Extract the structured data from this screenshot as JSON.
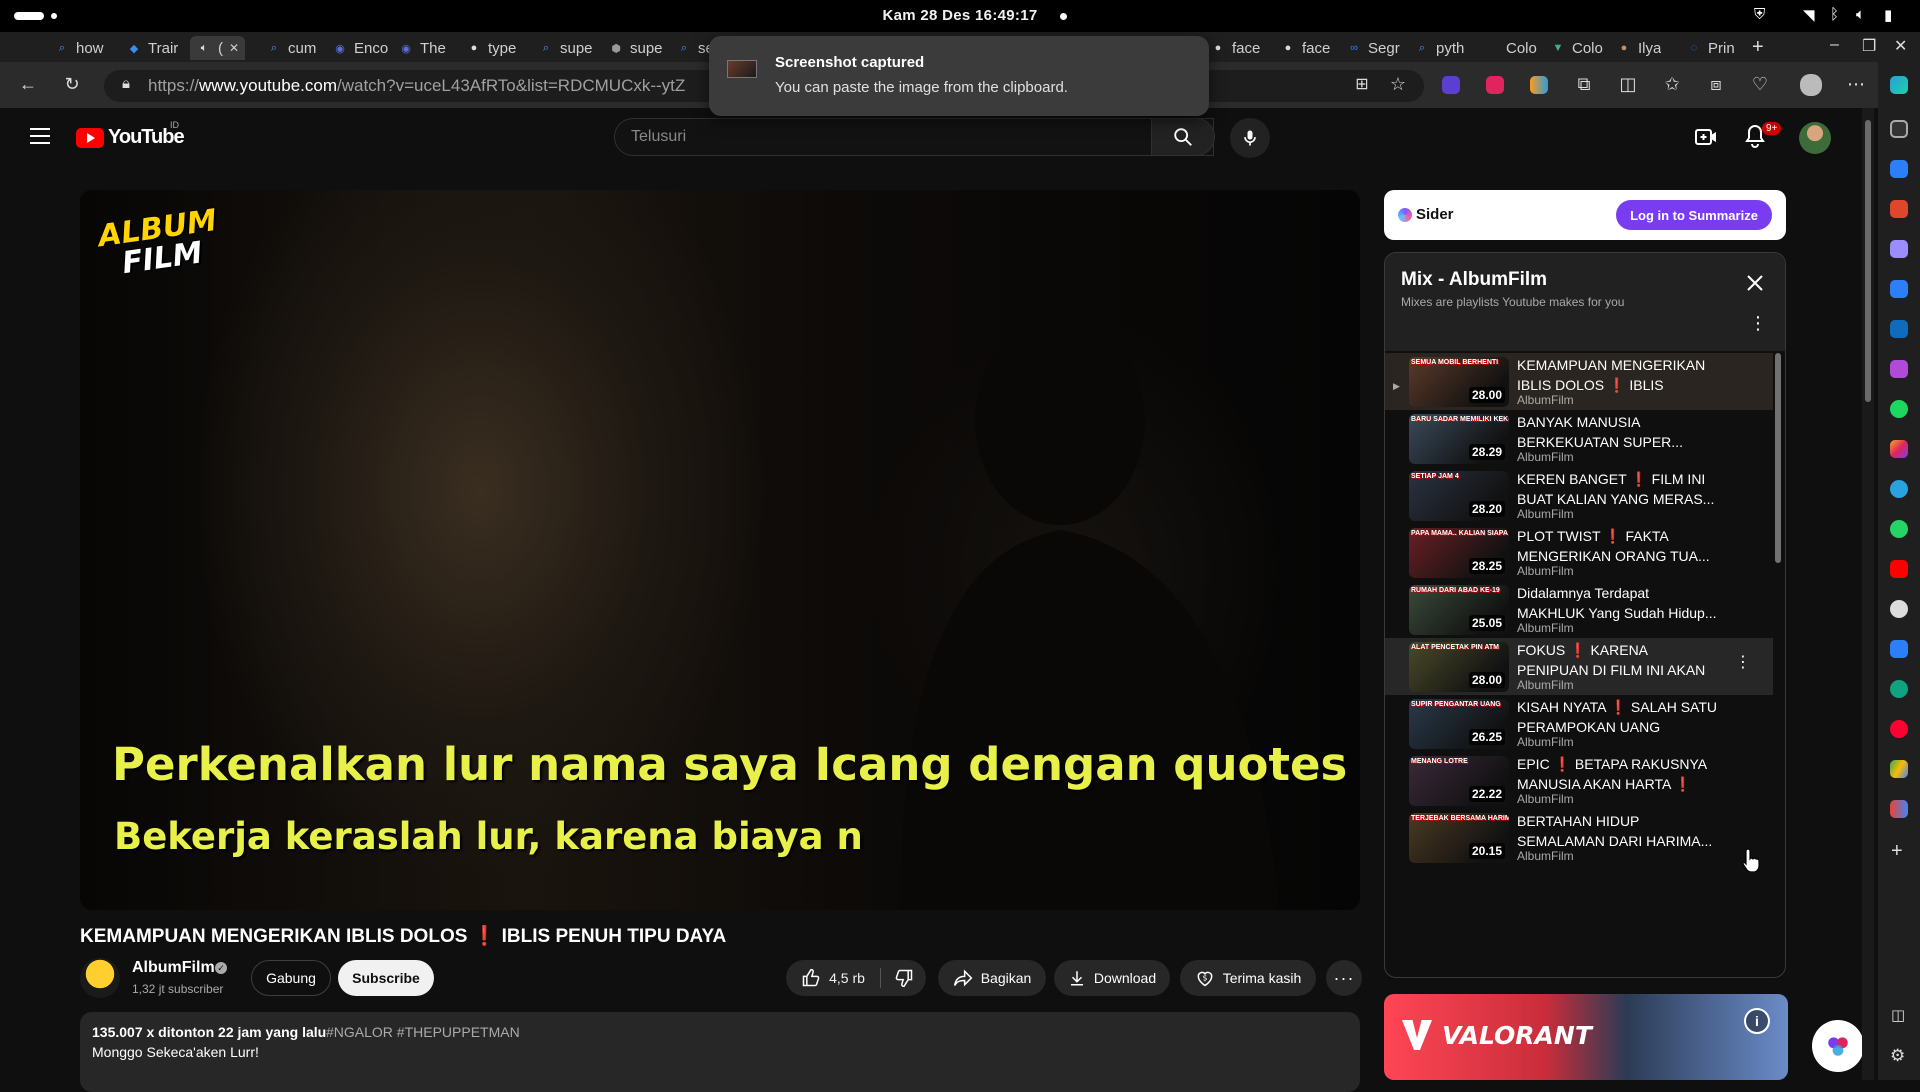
{
  "os": {
    "clock": "Kam 28 Des  16:49:17"
  },
  "tabs": [
    {
      "label": "how",
      "icon": "search-icon",
      "color": "#4b8ff5"
    },
    {
      "label": "Trair",
      "icon": "flutter-icon",
      "color": "#3f8cf0"
    },
    {
      "label": "(",
      "icon": "speaker-icon",
      "color": "#ddd",
      "active": true
    },
    {
      "label": "cum",
      "icon": "search-icon",
      "color": "#4b8ff5"
    },
    {
      "label": "Enco",
      "icon": "globe-icon",
      "color": "#5a6fd8"
    },
    {
      "label": "The",
      "icon": "globe-icon",
      "color": "#5a6fd8"
    },
    {
      "label": "type",
      "icon": "github-icon",
      "color": "#ddd"
    },
    {
      "label": "supe",
      "icon": "search-icon",
      "color": "#4b8ff5"
    },
    {
      "label": "supe",
      "icon": "hexagon-icon",
      "color": "#999"
    },
    {
      "label": "se",
      "icon": "search-icon",
      "color": "#4b8ff5"
    },
    {
      "label": "face",
      "icon": "github-icon",
      "color": "#ddd"
    },
    {
      "label": "face",
      "icon": "github-icon",
      "color": "#ddd"
    },
    {
      "label": "Segr",
      "icon": "meta-icon",
      "color": "#2d7ff9"
    },
    {
      "label": "pyth",
      "icon": "search-icon",
      "color": "#4b8ff5"
    },
    {
      "label": "Colo",
      "icon": "blank-icon",
      "color": "#1f1f1f"
    },
    {
      "label": "Colo",
      "icon": "vue-icon",
      "color": "#3fb27f"
    },
    {
      "label": "Ilya",
      "icon": "face-icon",
      "color": "#c98b6b"
    },
    {
      "label": "Prin",
      "icon": "circle-icon",
      "color": "#2d7ff9"
    }
  ],
  "address": {
    "url_prefix": "https://",
    "url_host": "www.youtube.com",
    "url_path": "/watch?v=uceL43AfRTo&list=RDCMUCxk--ytZ"
  },
  "toast": {
    "title": "Screenshot captured",
    "body": "You can paste the image from the clipboard."
  },
  "youtube": {
    "logo_text": "YouTube",
    "region": "ID",
    "search_placeholder": "Telusuri",
    "notif_count": "9+"
  },
  "player": {
    "watermark_line1": "ALBUM",
    "watermark_line2": "FILM",
    "subtitle_line1": "Perkenalkan lur nama saya Icang dengan quotes hari ini",
    "subtitle_line2": "Bekerja keraslah lur, karena biaya n"
  },
  "video": {
    "title_part1": "KEMAMPUAN MENGERIKAN IBLIS DOLOS",
    "title_excl": "❗",
    "title_part2": "IBLIS PENUH TIPU DAYA",
    "channel": "AlbumFilm",
    "subscribers": "1,32 jt subscriber",
    "join_label": "Gabung",
    "subscribe_label": "Subscribe",
    "likes": "4,5 rb",
    "share_label": "Bagikan",
    "download_label": "Download",
    "thanks_label": "Terima kasih",
    "views_time": "135.007 x ditonton  22 jam yang lalu",
    "tags": "#NGALOR #THEPUPPETMAN",
    "description": "Monggo Sekeca'aken Lurr!"
  },
  "sider": {
    "name": "Sider",
    "button": "Log in to Summarize"
  },
  "playlist": {
    "title": "Mix - AlbumFilm",
    "subtitle": "Mixes are playlists Youtube makes for you",
    "items": [
      {
        "title": "KEMAMPUAN MENGERIKAN IBLIS DOLOS ❗ IBLIS PENUH...",
        "channel": "AlbumFilm",
        "duration": "28.00",
        "caption": "SEMUA MOBIL BERHENTI",
        "thumb": "#5a3a2a"
      },
      {
        "title": "BANYAK MANUSIA BERKEKUATAN SUPER...",
        "channel": "AlbumFilm",
        "duration": "28.29",
        "caption": "BARU SADAR MEMILIKI KEKUATAN SUPER",
        "thumb": "#3b4a5a"
      },
      {
        "title": "KEREN BANGET ❗ FILM INI BUAT KALIAN YANG MERAS...",
        "channel": "AlbumFilm",
        "duration": "28.20",
        "caption": "SETIAP JAM 4",
        "thumb": "#2b3340"
      },
      {
        "title": "PLOT TWIST ❗ FAKTA MENGERIKAN ORANG TUA...",
        "channel": "AlbumFilm",
        "duration": "28.25",
        "caption": "PAPA MAMA.. KALIAN SIAPA?!",
        "thumb": "#6a1f24"
      },
      {
        "title": "Didalamnya Terdapat MAKHLUK Yang Sudah Hidup...",
        "channel": "AlbumFilm",
        "duration": "25.05",
        "caption": "RUMAH DARI ABAD KE-19",
        "thumb": "#3a4a3a"
      },
      {
        "title": "FOKUS ❗ KARENA PENIPUAN DI FILM INI AKAN MEMBUAT...",
        "channel": "AlbumFilm",
        "duration": "28.00",
        "caption": "ALAT PENCETAK PIN ATM",
        "thumb": "#4a4a2a"
      },
      {
        "title": "KISAH NYATA ❗ SALAH SATU PERAMPOKAN UANG TUNAI...",
        "channel": "AlbumFilm",
        "duration": "26.25",
        "caption": "SUPIR PENGANTAR UANG",
        "thumb": "#2a3a4a"
      },
      {
        "title": "EPIC ❗ BETAPA RAKUSNYA MANUSIA AKAN HARTA ❗",
        "channel": "AlbumFilm",
        "duration": "22.22",
        "caption": "MENANG LOTRE",
        "thumb": "#3a2a3a"
      },
      {
        "title": "BERTAHAN HIDUP SEMALAMAN DARI HARIMA...",
        "channel": "AlbumFilm",
        "duration": "20.15",
        "caption": "TERJEBAK BERSAMA HARIMAU",
        "thumb": "#4a3a22"
      }
    ]
  },
  "ad": {
    "brand": "VALORANT",
    "info": "i"
  }
}
